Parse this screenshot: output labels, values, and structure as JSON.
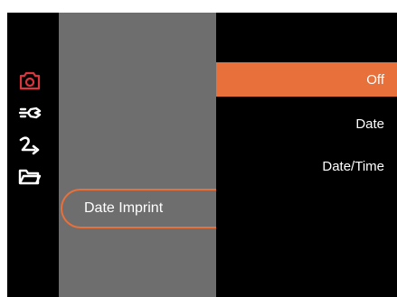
{
  "menu": {
    "current_item": "Date Imprint"
  },
  "options": [
    {
      "label": "Off",
      "selected": true
    },
    {
      "label": "Date",
      "selected": false
    },
    {
      "label": "Date/Time",
      "selected": false
    }
  ],
  "icons": {
    "camera": "camera-icon",
    "settings": "wrench-icon",
    "playback": "arrow-return-icon",
    "folder": "folder-icon"
  },
  "colors": {
    "accent": "#e8703a",
    "active_icon": "#d9363e",
    "panel": "#6e6e6e",
    "background": "#000000",
    "text": "#ffffff"
  }
}
